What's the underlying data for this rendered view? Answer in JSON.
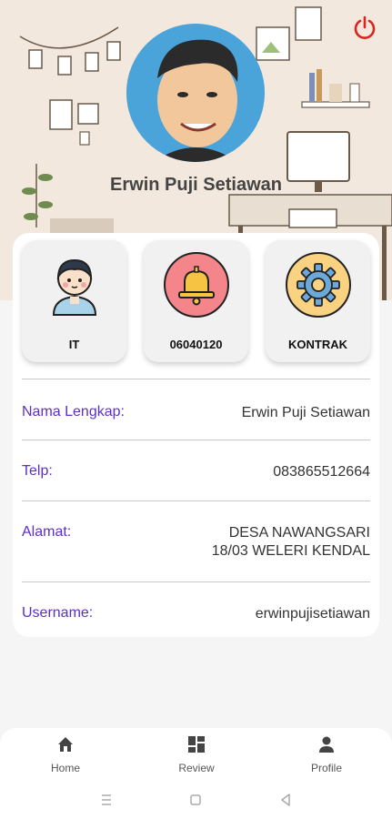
{
  "profile": {
    "name": "Erwin Puji Setiawan"
  },
  "tiles": [
    {
      "label": "IT",
      "icon": "employee-avatar-icon"
    },
    {
      "label": "06040120",
      "icon": "bell-icon"
    },
    {
      "label": "KONTRAK",
      "icon": "gear-icon"
    }
  ],
  "details": {
    "full_name_label": "Nama Lengkap:",
    "full_name_value": "Erwin Puji Setiawan",
    "phone_label": "Telp:",
    "phone_value": "083865512664",
    "address_label": "Alamat:",
    "address_line1": "DESA NAWANGSARI",
    "address_line2": "18/03 WELERI KENDAL",
    "username_label": "Username:",
    "username_value": "erwinpujisetiawan"
  },
  "nav": {
    "home": "Home",
    "review": "Review",
    "profile": "Profile"
  },
  "colors": {
    "label_purple": "#5b2fc9",
    "power_red": "#d9251d",
    "header_beige": "#f2e8dd"
  }
}
